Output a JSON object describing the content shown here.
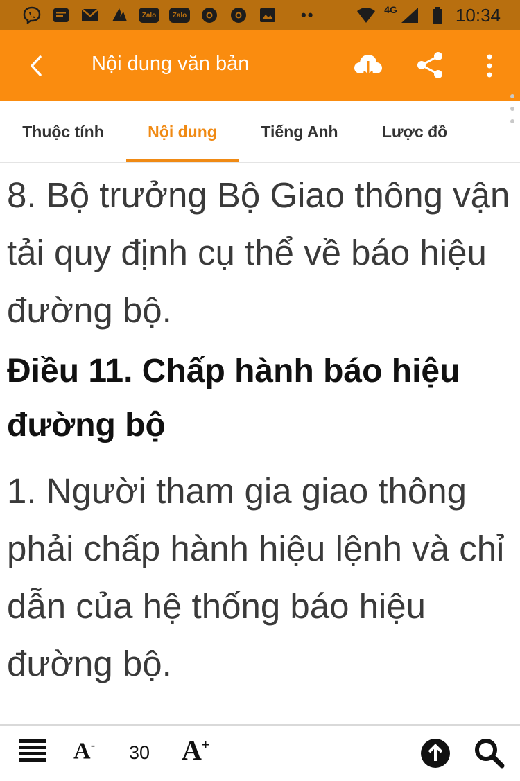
{
  "status_bar": {
    "time": "10:34",
    "network": "4G",
    "zalo_label": "Zalo",
    "overflow_dots": "••"
  },
  "app_bar": {
    "title": "Nội dung văn bản"
  },
  "tabs": [
    {
      "label": "Thuộc tính",
      "active": false
    },
    {
      "label": "Nội dung",
      "active": true
    },
    {
      "label": "Tiếng Anh",
      "active": false
    },
    {
      "label": "Lược đồ",
      "active": false
    }
  ],
  "content": {
    "para_8": "8. Bộ trưởng Bộ Giao thông vận tải quy định cụ thể về báo hiệu đường bộ.",
    "heading": "Điều 11. Chấp hành báo hiệu đường bộ",
    "para_1": "1. Người tham gia giao thông phải chấp hành hiệu lệnh và chỉ dẫn của hệ thống báo hiệu đường bộ."
  },
  "bottom_bar": {
    "font_decrease": "A",
    "font_decrease_sign": "-",
    "font_size": "30",
    "font_increase": "A",
    "font_increase_sign": "+"
  },
  "colors": {
    "accent": "#fa8c0f",
    "status_bar": "#b86f0f",
    "active_tab": "#f08a14"
  }
}
